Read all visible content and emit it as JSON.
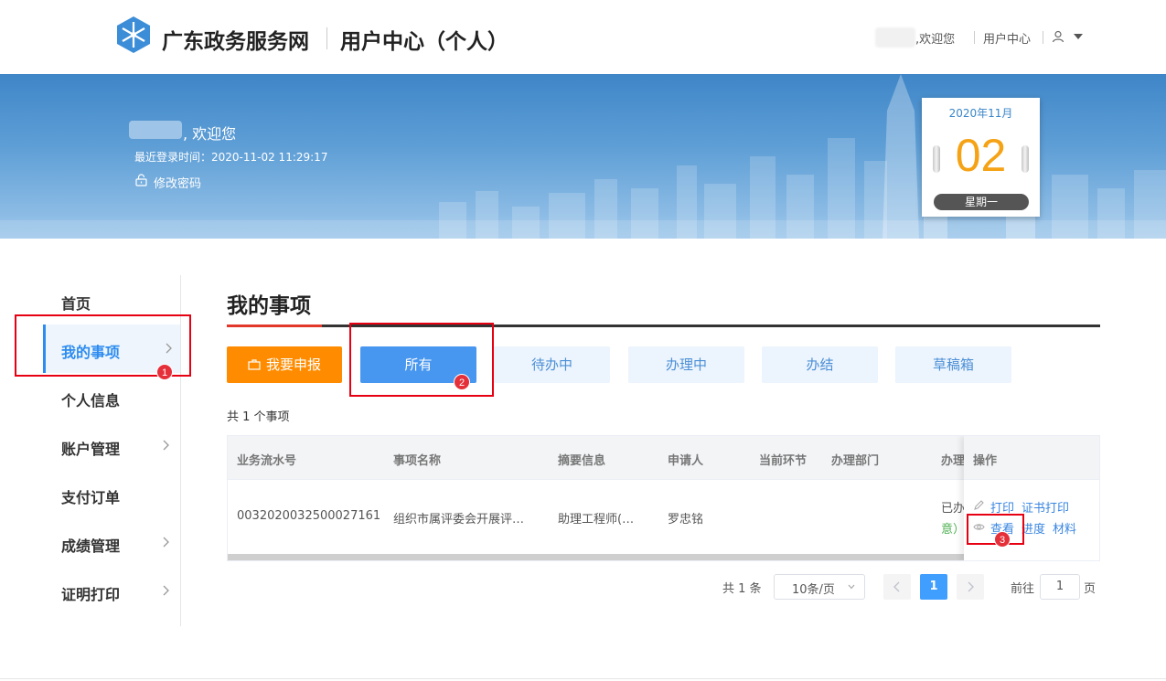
{
  "header": {
    "site_title": "广东政务服务网",
    "center_title": "用户中心（个人）",
    "welcome": ",欢迎您",
    "user_center_link": "用户中心"
  },
  "banner": {
    "welcome": ", 欢迎您",
    "last_login": "最近登录时间：2020-11-02 11:29:17",
    "change_password": "修改密码",
    "calendar": {
      "month": "2020年11月",
      "day": "02",
      "weekday": "星期一"
    }
  },
  "sidebar": {
    "items": [
      {
        "label": "首页",
        "has_arrow": false
      },
      {
        "label": "我的事项",
        "has_arrow": true,
        "active": true
      },
      {
        "label": "个人信息",
        "has_arrow": false
      },
      {
        "label": "账户管理",
        "has_arrow": true
      },
      {
        "label": "支付订单",
        "has_arrow": false
      },
      {
        "label": "成绩管理",
        "has_arrow": true
      },
      {
        "label": "证明打印",
        "has_arrow": true
      }
    ]
  },
  "annotations": {
    "badge_1": "1",
    "badge_2": "2",
    "badge_3": "3",
    "color": "#e60012"
  },
  "main": {
    "title": "我的事项",
    "apply_button": "我要申报",
    "tabs": [
      {
        "label": "所有",
        "active": true
      },
      {
        "label": "待办中"
      },
      {
        "label": "办理中"
      },
      {
        "label": "办结"
      },
      {
        "label": "草稿箱"
      }
    ],
    "count_text": "共 1 个事项"
  },
  "table": {
    "headers": [
      "业务流水号",
      "事项名称",
      "摘要信息",
      "申请人",
      "当前环节",
      "办理部门",
      "办理",
      "操作"
    ],
    "rows": [
      {
        "serial": "0032020032500027161",
        "name": "组织市属评委会开展评…",
        "summary": "助理工程师(…",
        "applicant": "罗忠铭",
        "status_line1": "已办",
        "status_line2": "意）"
      }
    ],
    "actions": {
      "print": "打印",
      "cert_print": "证书打印",
      "view": "查看",
      "progress": "进度",
      "material": "材料"
    }
  },
  "pagination": {
    "total": "共 1 条",
    "page_size": "10条/页",
    "current_page": "1",
    "goto_label": "前往",
    "goto_value": "1",
    "page_suffix": "页"
  },
  "colors": {
    "accent": "#2d8cf0",
    "apply": "#ff8c00",
    "active_tab": "#4796ef",
    "calendar_day": "#f5a215"
  }
}
